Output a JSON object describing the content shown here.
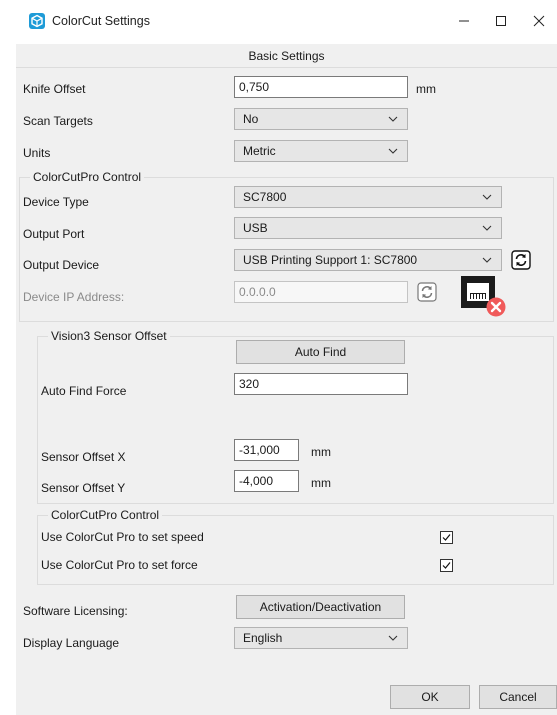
{
  "window": {
    "title": "ColorCut Settings",
    "minimize_icon": "minimize-icon",
    "maximize_icon": "maximize-icon",
    "close_icon": "close-icon"
  },
  "header": {
    "title": "Basic Settings"
  },
  "basic": {
    "knife_offset_label": "Knife Offset",
    "knife_offset_value": "0,750",
    "knife_offset_unit": "mm",
    "scan_targets_label": "Scan Targets",
    "scan_targets_value": "No",
    "units_label": "Units",
    "units_value": "Metric"
  },
  "control_group": {
    "legend": "ColorCutPro Control",
    "device_type_label": "Device Type",
    "device_type_value": "SC7800",
    "output_port_label": "Output Port",
    "output_port_value": "USB",
    "output_device_label": "Output Device",
    "output_device_value": "USB Printing Support 1: SC7800",
    "device_ip_label": "Device IP Address:",
    "device_ip_value": "0.0.0.0"
  },
  "vision_group": {
    "legend": "Vision3 Sensor Offset",
    "auto_find_button": "Auto Find",
    "auto_find_force_label": "Auto Find Force",
    "auto_find_force_value": "320",
    "sensor_offset_x_label": "Sensor Offset X",
    "sensor_offset_x_value": "-31,000",
    "sensor_offset_x_unit": "mm",
    "sensor_offset_y_label": "Sensor Offset Y",
    "sensor_offset_y_value": "-4,000",
    "sensor_offset_y_unit": "mm"
  },
  "pro_group": {
    "legend": "ColorCutPro Control",
    "set_speed_label": "Use ColorCut Pro to set speed",
    "set_speed_checked": true,
    "set_force_label": "Use ColorCut Pro to set force",
    "set_force_checked": true
  },
  "footer": {
    "licensing_label": "Software Licensing:",
    "licensing_button": "Activation/Deactivation",
    "language_label": "Display Language",
    "language_value": "English",
    "ok_button": "OK",
    "cancel_button": "Cancel"
  },
  "colors": {
    "app_icon": "#1e9bd7",
    "error_badge": "#f05a5a",
    "panel_bg": "#f0f0f0"
  }
}
